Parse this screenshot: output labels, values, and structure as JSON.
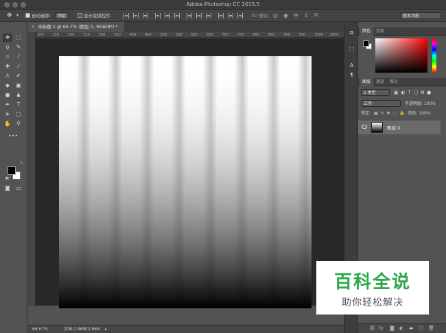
{
  "window": {
    "title": "Adobe Photoshop CC 2015.5"
  },
  "options_bar": {
    "auto_select_label": "自动选择:",
    "auto_select_value": "图层",
    "show_transform_label": "显示变换控件",
    "mode_3d_label": "3D 模式:",
    "workspace": "基本功能"
  },
  "document": {
    "tab_title": "未标题-1 @ 66.7% (图层 0, RGB/8*) *",
    "ruler_ticks": [
      "100",
      "150",
      "200",
      "250",
      "300",
      "350",
      "400",
      "450",
      "500",
      "550",
      "600",
      "650",
      "700",
      "750",
      "800",
      "850",
      "900",
      "950",
      "1000",
      "1050"
    ],
    "stripes": 8
  },
  "status": {
    "zoom": "66.67%",
    "doc_size": "文档:2.86M/2.86M"
  },
  "color_panel": {
    "tab_swatches": "颜色",
    "tab_color": "色板"
  },
  "layers_panel": {
    "tabs": [
      "图层",
      "通道",
      "路径"
    ],
    "filter_label": "ρ 类型",
    "blend_mode": "正常",
    "opacity_label": "不透明度:",
    "opacity_value": "100%",
    "lock_label": "锁定:",
    "fill_label": "填充:",
    "fill_value": "100%",
    "layer_name": "图层 0"
  },
  "watermark": {
    "title": "百科全说",
    "subtitle": "助你轻松解决"
  }
}
